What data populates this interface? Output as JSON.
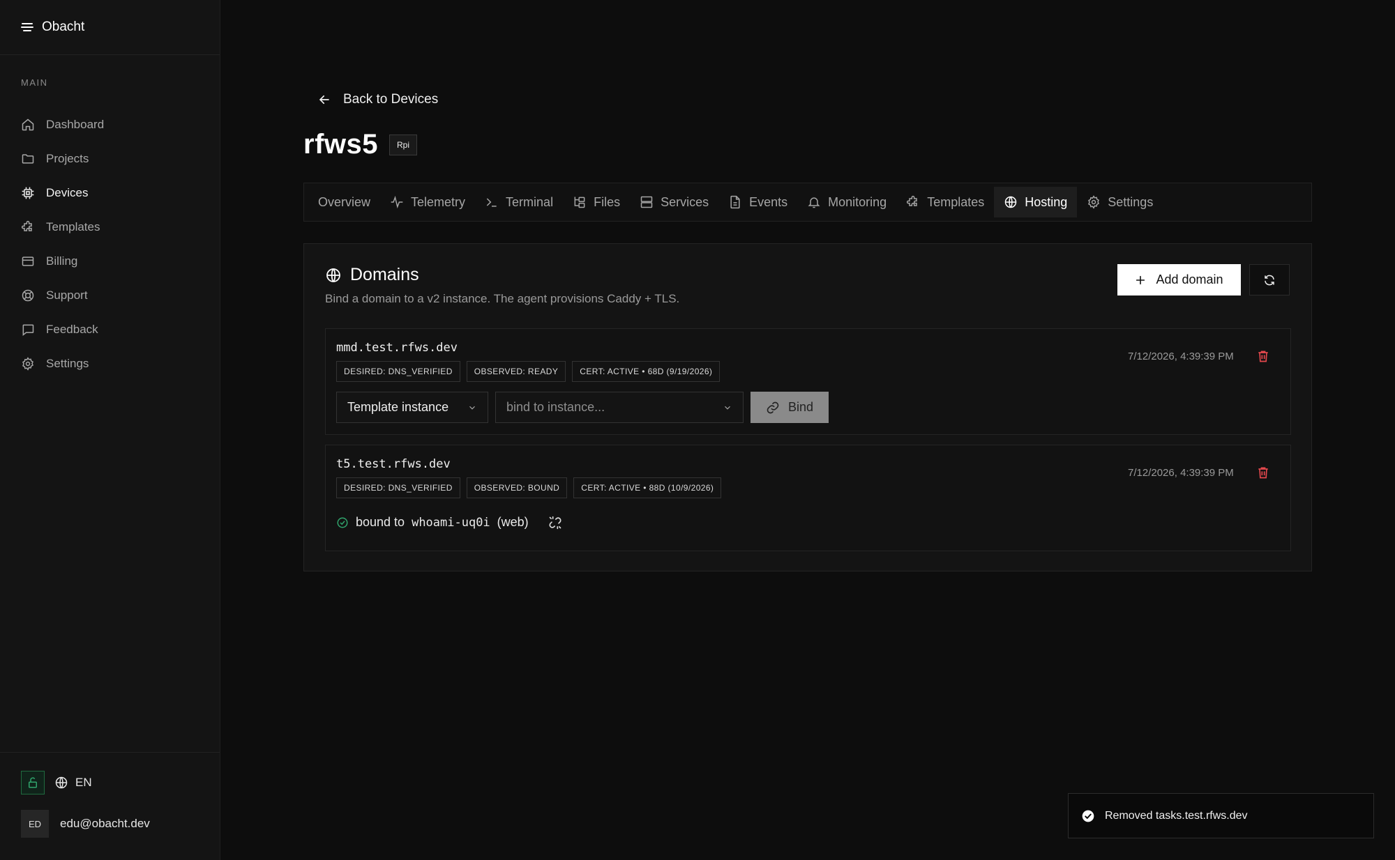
{
  "app": {
    "name": "Obacht"
  },
  "sidebar": {
    "section": "MAIN",
    "items": [
      {
        "label": "Dashboard",
        "icon": "home-icon"
      },
      {
        "label": "Projects",
        "icon": "folder-icon"
      },
      {
        "label": "Devices",
        "icon": "chip-icon"
      },
      {
        "label": "Templates",
        "icon": "puzzle-icon"
      },
      {
        "label": "Billing",
        "icon": "credit-card-icon"
      },
      {
        "label": "Support",
        "icon": "lifebuoy-icon"
      },
      {
        "label": "Feedback",
        "icon": "message-icon"
      },
      {
        "label": "Settings",
        "icon": "gear-icon"
      }
    ],
    "active": "Devices",
    "language": "EN",
    "user": {
      "initials": "ED",
      "email": "edu@obacht.dev"
    }
  },
  "header": {
    "back_label": "Back to Devices",
    "title": "rfws5",
    "device_type": "Rpi"
  },
  "tabs": [
    {
      "label": "Overview",
      "icon": ""
    },
    {
      "label": "Telemetry",
      "icon": "activity-icon"
    },
    {
      "label": "Terminal",
      "icon": "terminal-icon"
    },
    {
      "label": "Files",
      "icon": "folder-tree-icon"
    },
    {
      "label": "Services",
      "icon": "server-icon"
    },
    {
      "label": "Events",
      "icon": "file-text-icon"
    },
    {
      "label": "Monitoring",
      "icon": "bell-icon"
    },
    {
      "label": "Templates",
      "icon": "puzzle-icon"
    },
    {
      "label": "Hosting",
      "icon": "globe-icon"
    },
    {
      "label": "Settings",
      "icon": "gear-icon"
    }
  ],
  "active_tab": "Hosting",
  "domains_card": {
    "title": "Domains",
    "subtitle": "Bind a domain to a v2 instance. The agent provisions Caddy + TLS.",
    "add_label": "Add domain",
    "domains": [
      {
        "name": "mmd.test.rfws.dev",
        "desired": "DESIRED: DNS_VERIFIED",
        "observed": "OBSERVED: READY",
        "cert": "CERT: ACTIVE • 68D (9/19/2026)",
        "timestamp": "7/12/2026, 4:39:39 PM",
        "kind_select": "Template instance",
        "instance_placeholder": "bind to instance...",
        "bind_label": "Bind"
      },
      {
        "name": "t5.test.rfws.dev",
        "desired": "DESIRED: DNS_VERIFIED",
        "observed": "OBSERVED: BOUND",
        "cert": "CERT: ACTIVE • 88D (10/9/2026)",
        "timestamp": "7/12/2026, 4:39:39 PM",
        "bound_prefix": "bound to",
        "bound_instance": "whoami-uq0i",
        "bound_suffix": "(web)"
      }
    ]
  },
  "toast": {
    "message": "Removed tasks.test.rfws.dev"
  },
  "colors": {
    "background": "#0d0d0d",
    "sidebar": "#141414",
    "danger": "#e5484d",
    "success": "#30a46c",
    "primary_button": "#ffffff"
  }
}
